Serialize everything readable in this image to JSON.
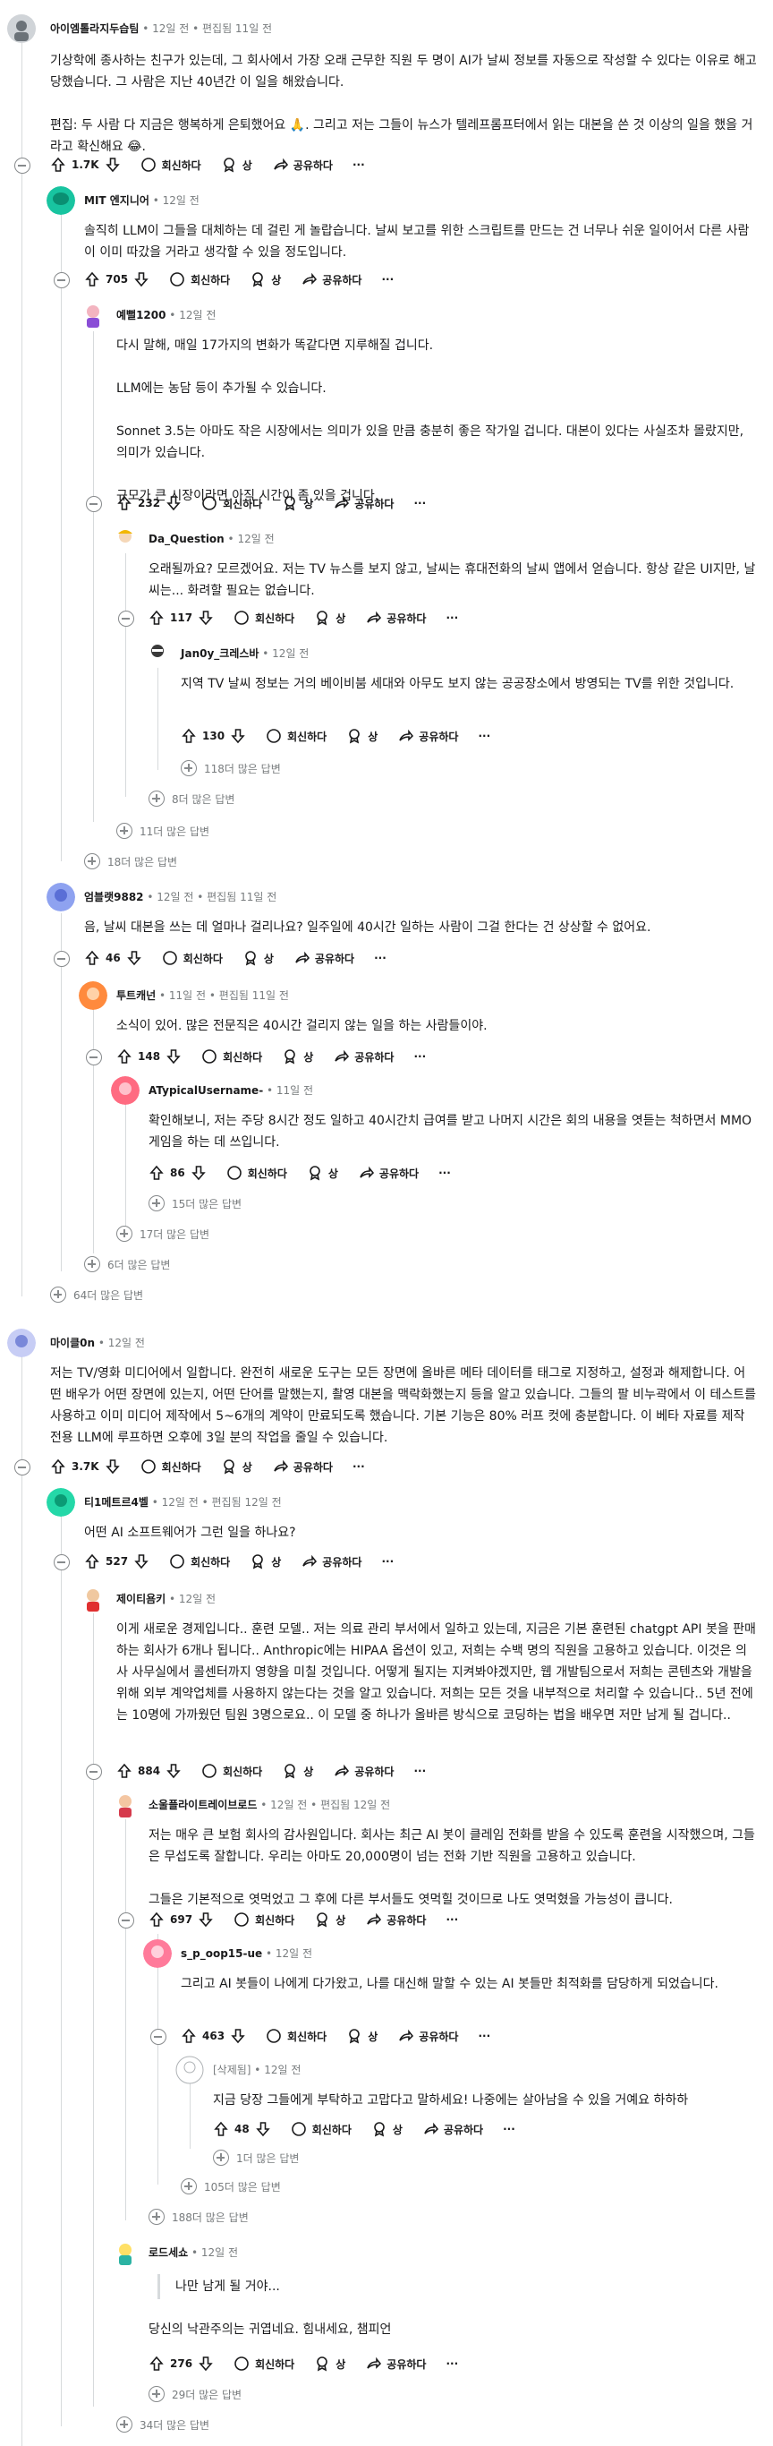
{
  "labels": {
    "reply": "회신하다",
    "award": "상",
    "share": "공유하다"
  },
  "comments": [
    {
      "id": "c1",
      "user": "아이엠톨라지두습팀",
      "time": "12일 전",
      "edited": "편집됨 11일 전",
      "body": "기상학에 종사하는 친구가 있는데, 그 회사에서 가장 오래 근무한 직원 두 명이 AI가 날씨 정보를 자동으로 작성할 수 있다는 이유로 해고당했습니다. 그 사람은 지난 40년간 이 일을 해왔습니다.\n\n편집: 두 사람 다 지금은 행복하게 은퇴했어요 🙏. 그리고 저는 그들이 뉴스가 텔레프롬프터에서 읽는 대본을 쓴 것 이상의 일을 했을 거라고 확신해요 😂.",
      "votes": "1.7K"
    },
    {
      "id": "c2",
      "user": "MIT 엔지니어",
      "time": "12일 전",
      "body": "솔직히 LLM이 그들을 대체하는 데 걸린 게 놀랍습니다. 날씨 보고를 위한 스크립트를 만드는 건 너무나 쉬운 일이어서 다른 사람이 이미 따갔을 거라고 생각할 수 있을 정도입니다.",
      "votes": "705"
    },
    {
      "id": "c3",
      "user": "예뻘1200",
      "time": "12일 전",
      "body": "다시 말해, 매일 17가지의 변화가 똑같다면 지루해질 겁니다.\n\nLLM에는 농담 등이 추가될 수 있습니다.\n\nSonnet 3.5는 아마도 작은 시장에서는 의미가 있을 만큼 충분히 좋은 작가일 겁니다. 대본이 있다는 사실조차 몰랐지만, 의미가 있습니다.\n\n규모가 큰 시장이라면 아직 시간이 좀 있을 겁니다.",
      "votes": "232"
    },
    {
      "id": "c4",
      "user": "Da_Question",
      "time": "12일 전",
      "body": "오래될까요? 모르겠어요. 저는 TV 뉴스를 보지 않고, 날씨는 휴대전화의 날씨 앱에서 얻습니다. 항상 같은 UI지만, 날씨는... 화려할 필요는 없습니다.",
      "votes": "117"
    },
    {
      "id": "c5",
      "user": "Jan0y_크레스바",
      "time": "12일 전",
      "body": "지역 TV 날씨 정보는 거의 베이비붐 세대와 아무도 보지 않는 공공장소에서 방영되는 TV를 위한 것입니다.",
      "votes": "130"
    },
    {
      "id": "c6",
      "user": "엄블랫9882",
      "time": "12일 전",
      "edited": "편집됨 11일 전",
      "body": "음, 날씨 대본을 쓰는 데 얼마나 걸리나요? 일주일에 40시간 일하는 사람이 그걸 한다는 건 상상할 수 없어요.",
      "votes": "46"
    },
    {
      "id": "c7",
      "user": "투트캐넌",
      "time": "11일 전",
      "edited": "편집됨 11일 전",
      "body": "소식이 있어. 많은 전문직은 40시간 걸리지 않는 일을 하는 사람들이야.",
      "votes": "148"
    },
    {
      "id": "c8",
      "user": "ATypicalUsername-",
      "time": "11일 전",
      "body": "확인해보니, 저는 주당 8시간 정도 일하고 40시간치 급여를 받고 나머지 시간은 회의 내용을 엿듣는 척하면서 MMO 게임을 하는 데 쓰입니다.",
      "votes": "86"
    },
    {
      "id": "c9",
      "user": "마이클0n",
      "time": "12일 전",
      "body": "저는 TV/영화 미디어에서 일합니다. 완전히 새로운 도구는 모든 장면에 올바른 메타 데이터를 태그로 지정하고, 설정과 해제합니다. 어떤 배우가 어떤 장면에 있는지, 어떤 단어를 말했는지, 촬영 대본을 맥락화했는지 등을 알고 있습니다. 그들의 팔 비누곽에서 이 테스트를 사용하고 이미 미디어 제작에서 5~6개의 계약이 만료되도록 했습니다. 기본 기능은 80% 러프 컷에 충분합니다. 이 베타 자료를 제작 전용 LLM에 루프하면 오후에 3일 분의 작업을 줄일 수 있습니다.",
      "votes": "3.7K"
    },
    {
      "id": "c10",
      "user": "티1메트르4벨",
      "time": "12일 전",
      "edited": "편집됨 12일 전",
      "body": "어떤 AI 소프트웨어가 그런 일을 하나요?",
      "votes": "527"
    },
    {
      "id": "c11",
      "user": "제이티욤키",
      "time": "12일 전",
      "body": "이게 새로운 경제입니다.. 훈련 모델.. 저는 의료 관리 부서에서 일하고 있는데, 지금은 기본 훈련된 chatgpt API 봇을 판매하는 회사가 6개나 됩니다.. Anthropic에는 HIPAA 옵션이 있고, 저희는 수백 명의 직원을 고용하고 있습니다. 이것은 의사 사무실에서 콜센터까지 영향을 미칠 것입니다. 어떻게 될지는 지켜봐야겠지만, 웹 개발팀으로서 저희는 콘텐츠와 개발을 위해 외부 계약업체를 사용하지 않는다는 것을 알고 있습니다. 저희는 모든 것을 내부적으로 처리할 수 있습니다.. 5년 전에는 10명에 가까웠던 팀원 3명으로요.. 이 모델 중 하나가 올바른 방식으로 코딩하는 법을 배우면 저만 남게 될 겁니다..",
      "votes": "884"
    },
    {
      "id": "c12",
      "user": "소울플라이트레이브로드",
      "time": "12일 전",
      "edited": "편집됨 12일 전",
      "body": "저는 매우 큰 보험 회사의 감사원입니다. 회사는 최근 AI 봇이 클레임 전화를 받을 수 있도록 훈련을 시작했으며, 그들은 무섭도록 잘합니다. 우리는 아마도 20,000명이 넘는 전화 기반 직원을 고용하고 있습니다.\n\n그들은 기본적으로 엿먹었고 그 후에 다른 부서들도 엿먹힐 것이므로 나도 엿먹혔을 가능성이 큽니다.",
      "votes": "697"
    },
    {
      "id": "c13",
      "user": "s_p_oop15-ue",
      "time": "12일 전",
      "body": "그리고 AI 봇들이 나에게 다가왔고, 나를 대신해 말할 수 있는 AI 봇들만 최적화를 담당하게 되었습니다.",
      "votes": "463"
    },
    {
      "id": "c14",
      "user": "[삭제됨]",
      "time": "12일 전",
      "body": "지금 당장 그들에게 부탁하고 고맙다고 말하세요! 나중에는 살아남을 수 있을 거예요 하하하",
      "votes": "48"
    },
    {
      "id": "c15",
      "user": "로드세쇼",
      "time": "12일 전",
      "quote": "나만 남게 될 거야...",
      "body": "당신의 낙관주의는 귀엽네요. 힘내세요, 챔피언",
      "votes": "276"
    }
  ],
  "more": {
    "m118": "118더 많은 답변",
    "m8": "8더 많은 답변",
    "m11": "11더 많은 답변",
    "m18": "18더 많은 답변",
    "m15": "15더 많은 답변",
    "m17": "17더 많은 답변",
    "m6": "6더 많은 답변",
    "m64": "64더 많은 답변",
    "m1": "1더 많은 답변",
    "m105": "105더 많은 답변",
    "m188": "188더 많은 답변",
    "m29": "29더 많은 답변",
    "m34": "34더 많은 답변"
  },
  "colors": {
    "upvote": "#1a1a1b",
    "line": "#d7dadc",
    "meta": "#787c7e"
  }
}
